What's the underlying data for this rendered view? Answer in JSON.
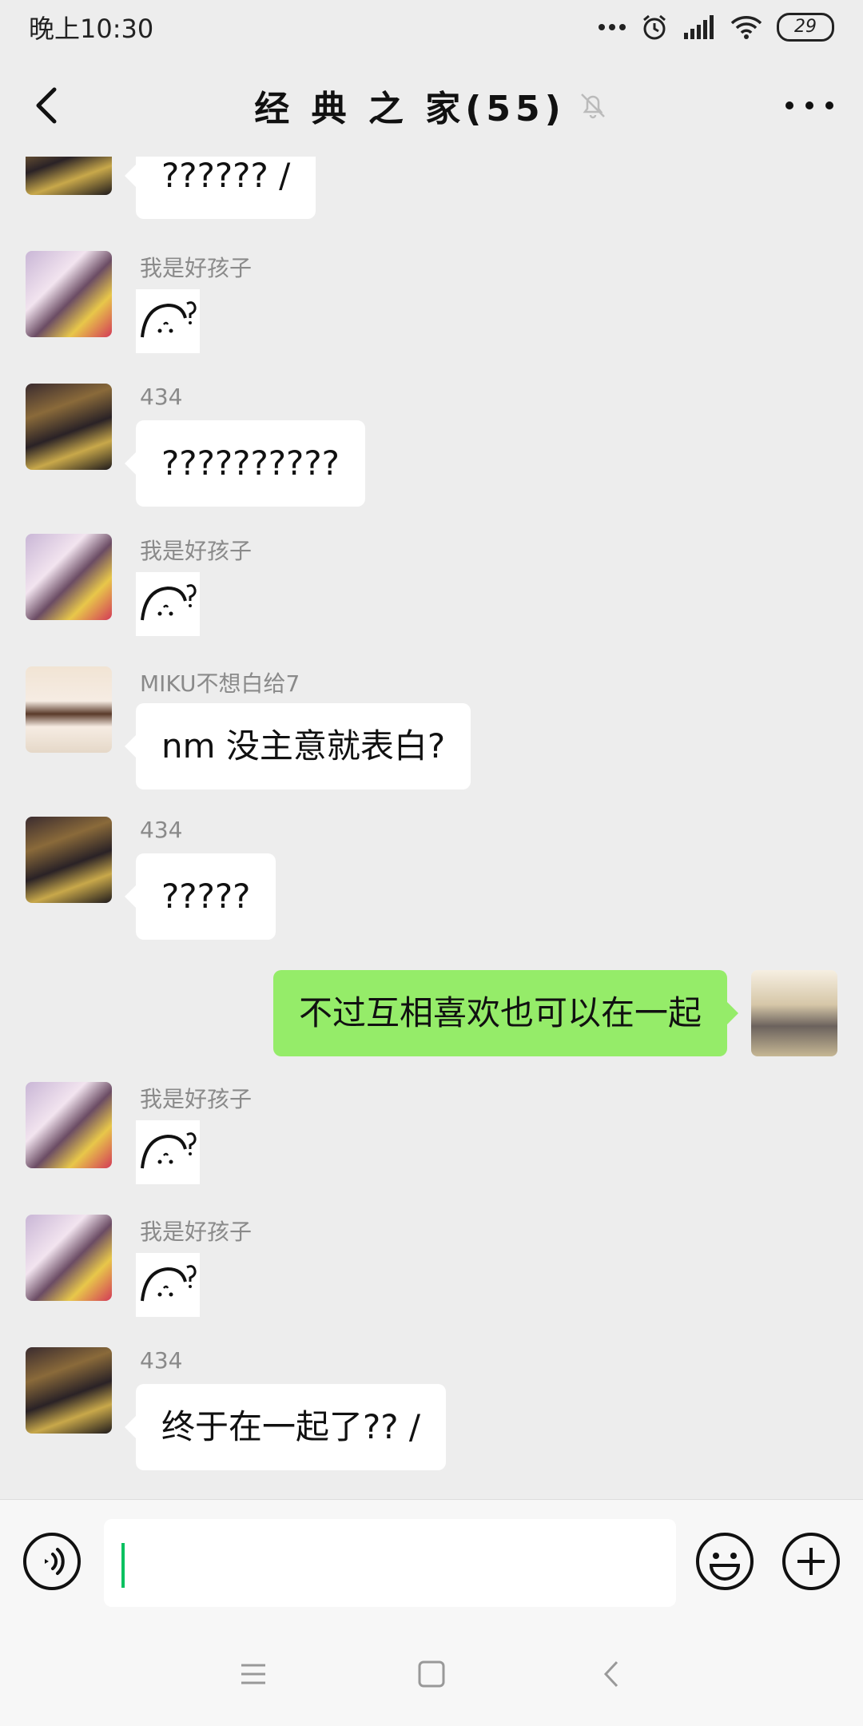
{
  "status": {
    "time": "晚上10:30",
    "battery": "29"
  },
  "header": {
    "title": "经 典 之 家(55)"
  },
  "messages": [
    {
      "text": "?????? /"
    },
    {
      "sender": "我是好孩子"
    },
    {
      "sender": "434",
      "text": "??????????"
    },
    {
      "sender": "我是好孩子"
    },
    {
      "sender": "MIKU不想白给7",
      "text": "nm 没主意就表白?"
    },
    {
      "sender": "434",
      "text": "?????"
    },
    {
      "text": "不过互相喜欢也可以在一起"
    },
    {
      "sender": "我是好孩子"
    },
    {
      "sender": "我是好孩子"
    },
    {
      "sender": "434",
      "text": "终于在一起了?? /"
    }
  ],
  "colors": {
    "background": "#ededed",
    "self_bubble": "#95ec69",
    "cursor": "#07c160"
  }
}
